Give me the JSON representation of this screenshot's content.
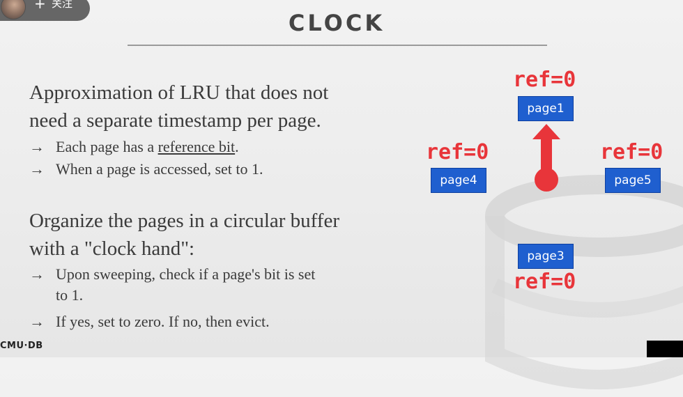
{
  "overlay": {
    "follow_plus": "+",
    "follow_label": "关注"
  },
  "slide": {
    "title": "CLOCK",
    "para1_line1": "Approximation of LRU that does not",
    "para1_line2": "need a separate timestamp per page.",
    "bullet1_arrow": "→",
    "bullet1_text_before": "Each page has a ",
    "bullet1_link": "reference bit",
    "bullet1_text_after": ".",
    "bullet2_arrow": "→",
    "bullet2_text": "When a page is accessed, set to 1.",
    "para2_line1": "Organize the pages in a circular buffer",
    "para2_line2": "with a \"clock hand\":",
    "bullet3_arrow": "→",
    "bullet3_line1": "Upon sweeping, check if a page's bit is set",
    "bullet3_line2": "to 1.",
    "bullet4_arrow": "→",
    "bullet4_text": "If yes, set to zero. If no, then evict."
  },
  "diagram": {
    "page1": {
      "label": "page1",
      "ref": "ref=0"
    },
    "page4": {
      "label": "page4",
      "ref": "ref=0"
    },
    "page5": {
      "label": "page5",
      "ref": "ref=0"
    },
    "page3": {
      "label": "page3",
      "ref": "ref=0"
    },
    "colors": {
      "ref_text": "#e8353a",
      "page_box": "#1f5fcf",
      "clock_hand": "#e8353a"
    }
  },
  "footer": {
    "logo": "CMU·DB"
  }
}
